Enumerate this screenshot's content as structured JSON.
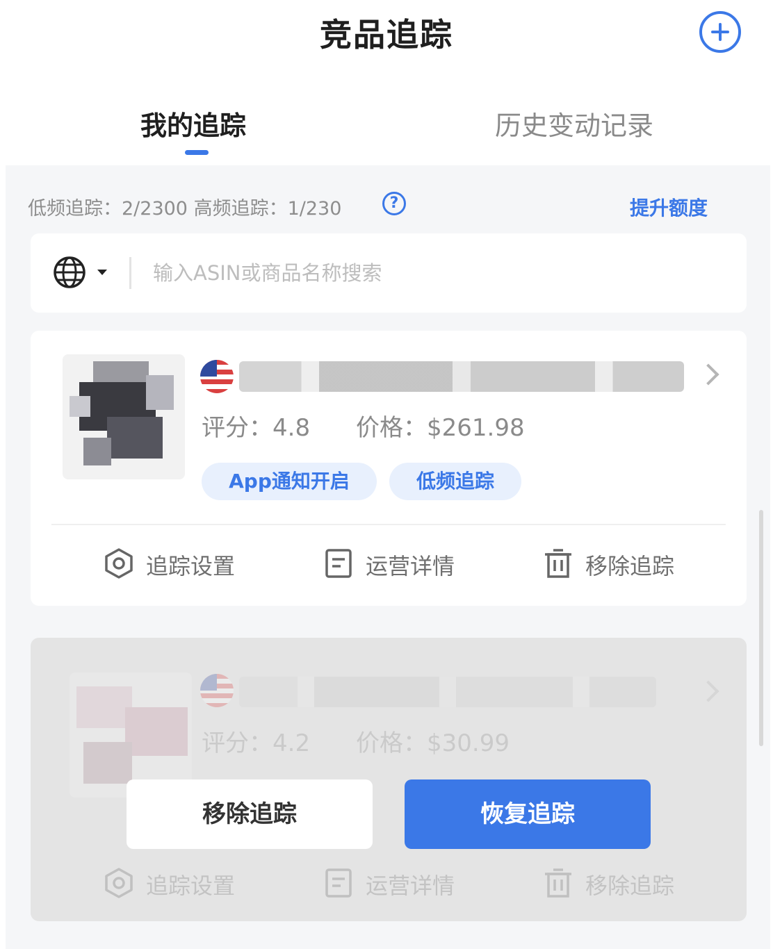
{
  "header": {
    "title": "竞品追踪",
    "add_icon": "plus-circle-icon"
  },
  "tabs": [
    {
      "label": "我的追踪",
      "active": true
    },
    {
      "label": "历史变动记录",
      "active": false
    }
  ],
  "quota": {
    "text": "低频追踪：2/2300 高频追踪：1/230",
    "help_icon": "question-circle-icon",
    "upgrade_label": "提升额度"
  },
  "search": {
    "region_icon": "globe-icon",
    "placeholder": "输入ASIN或商品名称搜索",
    "value": ""
  },
  "products": [
    {
      "flag": "us-flag-icon",
      "rating_text": "评分：4.8",
      "price_text": "价格：$261.98",
      "tags": [
        "App通知开启",
        "低频追踪"
      ],
      "actions": [
        {
          "label": "追踪设置",
          "icon": "settings-hexagon-icon"
        },
        {
          "label": "运营详情",
          "icon": "document-icon"
        },
        {
          "label": "移除追踪",
          "icon": "trash-icon"
        }
      ]
    },
    {
      "flag": "us-flag-icon",
      "rating_text": "评分：4.2",
      "price_text": "价格：$30.99",
      "actions": [
        {
          "label": "追踪设置",
          "icon": "settings-hexagon-icon"
        },
        {
          "label": "运营详情",
          "icon": "document-icon"
        },
        {
          "label": "移除追踪",
          "icon": "trash-icon"
        }
      ],
      "overlay": {
        "remove_label": "移除追踪",
        "restore_label": "恢复追踪"
      }
    }
  ],
  "colors": {
    "accent": "#3b78e7",
    "tag_bg": "#e8f0fd",
    "page_bg": "#f5f6f8"
  }
}
